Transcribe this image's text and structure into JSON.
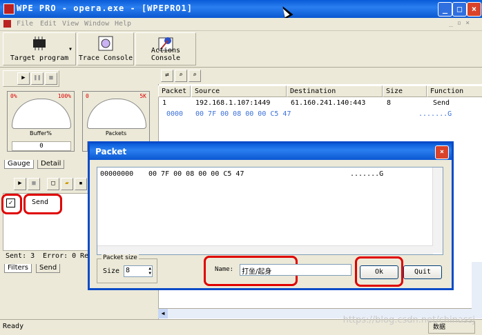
{
  "window": {
    "title": "WPE PRO - opera.exe - [WPEPRO1]"
  },
  "menu": [
    "File",
    "Edit",
    "View",
    "Window",
    "Help"
  ],
  "toolbar": {
    "target_program": "Target program",
    "trace_console": "Trace Console",
    "actions_console": "Actions Console"
  },
  "gauges": [
    {
      "name": "Buffer%",
      "min": "0%",
      "max": "100%",
      "value": "0"
    },
    {
      "name": "Packets",
      "min": "0",
      "max": "5K",
      "value": ""
    }
  ],
  "left_tabs": {
    "gauge": "Gauge",
    "detail": "Detail",
    "filters": "Filters",
    "send": "Send"
  },
  "send_list": {
    "item": "Send",
    "checked": true
  },
  "left_status": {
    "sent": "Sent: 3",
    "error": "Error: 0",
    "re": "Re"
  },
  "packet_table": {
    "columns": [
      "Packet",
      "Source",
      "Destination",
      "Size",
      "Function"
    ],
    "rows": [
      {
        "packet": "1",
        "source": "192.168.1.107:1449",
        "destination": "61.160.241.140:443",
        "size": "8",
        "function": "Send"
      }
    ],
    "hex_line": {
      "offset": "0000",
      "bytes": "00 7F 00 08 00 00 C5 47",
      "ascii": ".......G"
    }
  },
  "status": {
    "text": "Ready",
    "panel": "数据"
  },
  "dialog": {
    "title": "Packet",
    "dump": {
      "offset": "00000000",
      "bytes": "00 7F 00 08 00 00 C5 47",
      "ascii": ".......G"
    },
    "packet_size_group": "Packet size",
    "size_label": "Size",
    "size_value": "8",
    "name_label": "Name:",
    "name_value": "打坐/起身",
    "ok": "Ok",
    "quit": "Quit"
  },
  "watermark": "https://blog.csdn.net/chinassj",
  "colors": {
    "titlebar": "#0b57d0",
    "highlight": "#e00000",
    "hex_text": "#3a6fd8"
  }
}
